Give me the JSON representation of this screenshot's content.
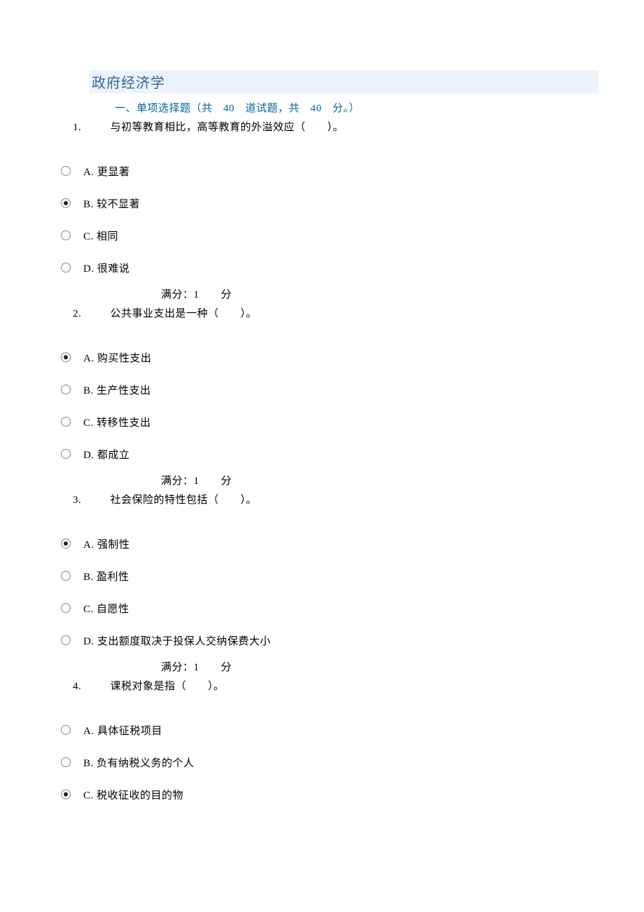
{
  "title": "政府经济学",
  "section_header": "一、单项选择题（共　40　道试题，共　40　分。）",
  "score_text": "满分：1　　分",
  "questions": [
    {
      "num": "1. ",
      "text": "　与初等教育相比，高等教育的外溢效应（　　）。",
      "selected": 1,
      "options": [
        "A. 更显著",
        "B. 较不显著",
        "C. 相同",
        "D. 很难说"
      ]
    },
    {
      "num": "2. ",
      "text": "　公共事业支出是一种（　　）。",
      "selected": 0,
      "options": [
        "A. 购买性支出",
        "B. 生产性支出",
        "C. 转移性支出",
        "D. 都成立"
      ]
    },
    {
      "num": "3. ",
      "text": "　社会保险的特性包括（　　）。",
      "selected": 0,
      "options": [
        "A. 强制性",
        "B. 盈利性",
        "C. 自愿性",
        "D. 支出额度取决于投保人交纳保费大小"
      ]
    },
    {
      "num": "4. ",
      "text": "　课税对象是指（　　）。",
      "selected": 2,
      "options": [
        "A. 具体征税项目",
        "B. 负有纳税义务的个人",
        "C. 税收征收的目的物"
      ]
    }
  ]
}
